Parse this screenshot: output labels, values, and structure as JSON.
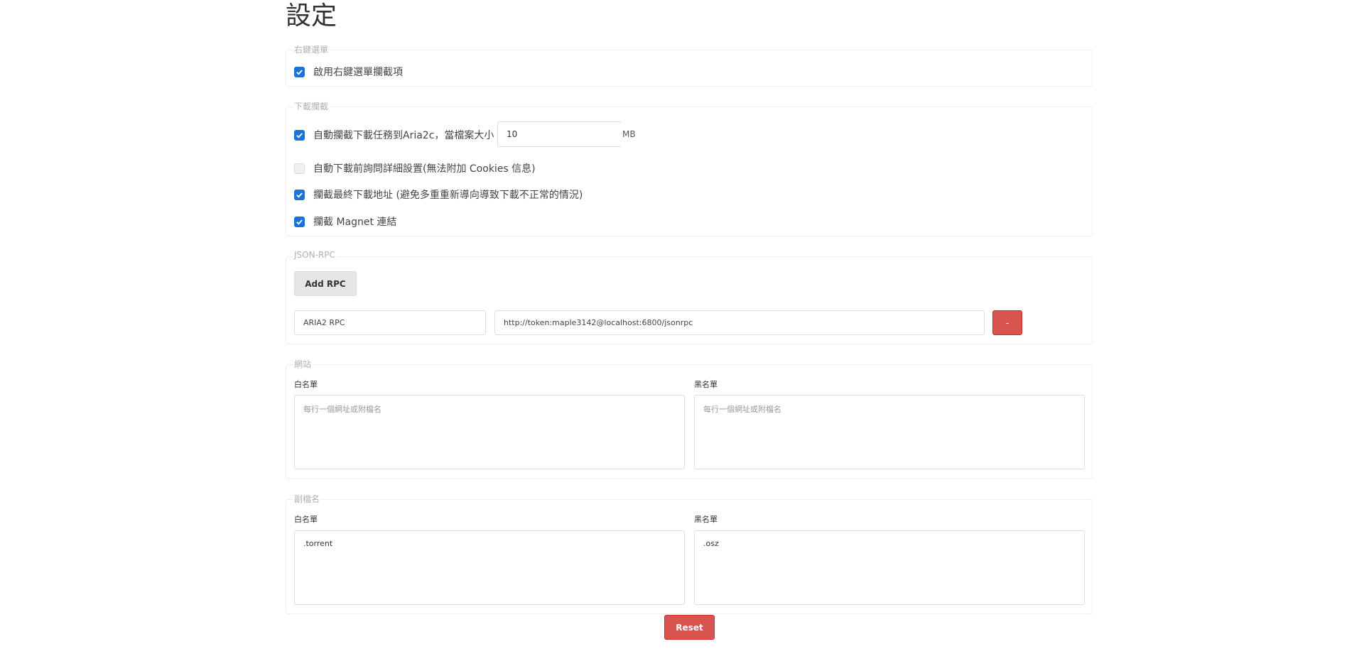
{
  "page": {
    "title": "設定"
  },
  "context_menu": {
    "legend": "右鍵選單",
    "enable_label": "啟用右鍵選單攔截項",
    "enable_checked": true
  },
  "download_capture": {
    "legend": "下載攔截",
    "auto_capture_label": "自動攔截下載任務到Aria2c，當檔案大小 ≥",
    "auto_capture_checked": true,
    "size_value": "10",
    "size_unit": "MB",
    "ask_details_label": "自動下載前詢問詳細設置(無法附加 Cookies 信息)",
    "ask_details_checked": false,
    "final_url_label": "攔截最終下載地址 (避免多重重新導向導致下載不正常的情況)",
    "final_url_checked": true,
    "magnet_label": "攔截 Magnet 連結",
    "magnet_checked": true
  },
  "json_rpc": {
    "legend": "JSON-RPC",
    "add_button": "Add RPC",
    "entries": [
      {
        "name": "ARIA2 RPC",
        "url": "http://token:maple3142@localhost:6800/jsonrpc",
        "remove_label": "-"
      }
    ]
  },
  "sites": {
    "legend": "網站",
    "whitelist_label": "白名單",
    "whitelist_placeholder": "每行一個網址或附檔名",
    "blacklist_label": "黑名單",
    "blacklist_placeholder": "每行一個網址或附檔名"
  },
  "extensions": {
    "legend": "副檔名",
    "whitelist_label": "白名單",
    "whitelist_value": ".torrent",
    "blacklist_label": "黑名單",
    "blacklist_value": ".osz"
  },
  "reset_button": "Reset",
  "colors": {
    "checkbox_checked": "#1a73d6",
    "danger": "#d9534f",
    "border": "#dddddd"
  }
}
